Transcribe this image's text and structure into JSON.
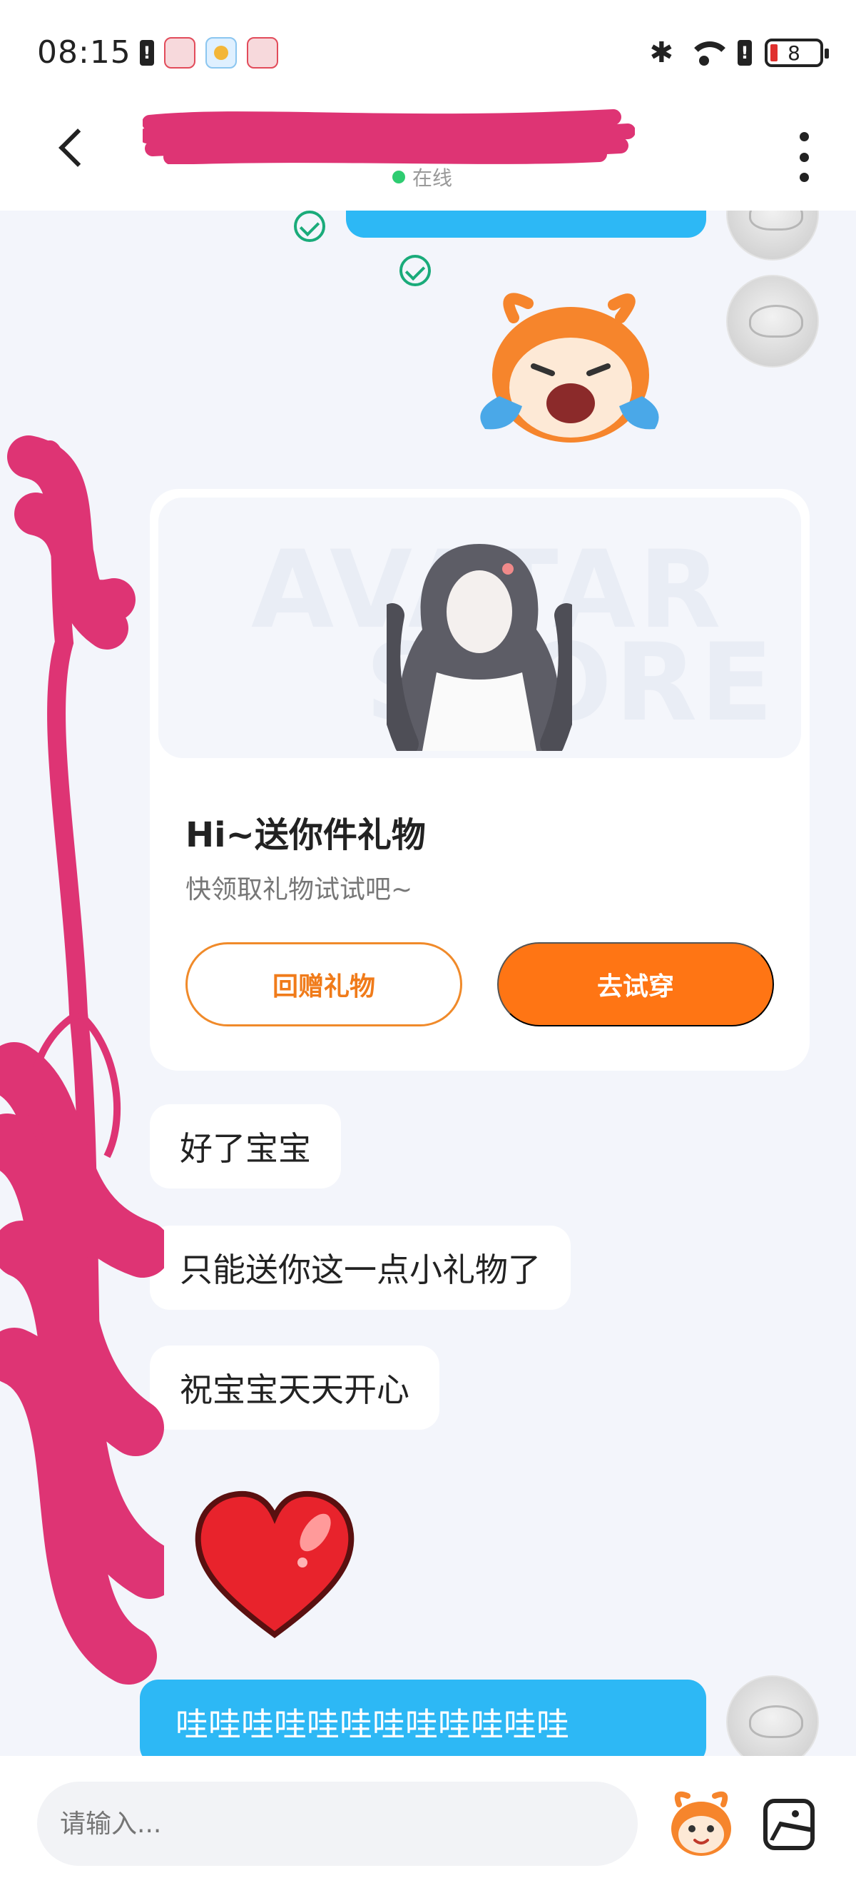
{
  "status_bar": {
    "time": "08:15",
    "battery": "8"
  },
  "header": {
    "contact_name": "",
    "status": "在线"
  },
  "messages": {
    "sent_top_text": "",
    "gift_card": {
      "title": "Hi~送你件礼物",
      "subtitle": "快领取礼物试试吧~",
      "return_gift_label": "回赠礼物",
      "try_on_label": "去试穿",
      "watermark_line1": "AVATAR",
      "watermark_line2": "STORE"
    },
    "received": [
      {
        "text": "好了宝宝"
      },
      {
        "text": "只能送你这一点小礼物了"
      },
      {
        "text": "祝宝宝天天开心"
      }
    ],
    "sent_bottom_text": "哇哇哇哇哇哇哇哇哇哇哇哇"
  },
  "input": {
    "placeholder": "请输入..."
  },
  "colors": {
    "sent_bubble": "#2db8f5",
    "accent_orange": "#ff7514",
    "online_green": "#2ecc71",
    "redaction_pink": "#de3474"
  },
  "icons": [
    "back-arrow-icon",
    "more-vertical-icon",
    "check-circle-icon",
    "crying-sticker",
    "heart-sticker",
    "emoji-icon",
    "image-icon"
  ]
}
